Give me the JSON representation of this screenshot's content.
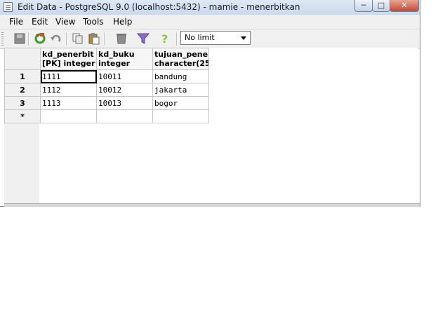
{
  "window": {
    "title": "Edit Data - PostgreSQL 9.0 (localhost:5432) - mamie - menerbitkan",
    "min_glyph": "─",
    "max_glyph": "□",
    "close_glyph": "✕"
  },
  "menu": [
    "File",
    "Edit",
    "View",
    "Tools",
    "Help"
  ],
  "toolbar": {
    "icons": [
      "save-icon",
      "refresh-icon",
      "undo-icon",
      "copy-icon",
      "paste-icon",
      "delete-icon",
      "filter-icon",
      "help-icon"
    ],
    "limit_select": "No limit"
  },
  "grid": {
    "columns": [
      {
        "name": "kd_penerbit",
        "type": "[PK] integer"
      },
      {
        "name": "kd_buku",
        "type": "integer"
      },
      {
        "name": "tujuan_pener",
        "type": "character(25"
      }
    ],
    "rows": [
      {
        "num": "1",
        "cells": [
          "1111",
          "10011",
          "bandung"
        ]
      },
      {
        "num": "2",
        "cells": [
          "1112",
          "10012",
          "jakarta"
        ]
      },
      {
        "num": "3",
        "cells": [
          "1113",
          "10013",
          "bogor"
        ]
      }
    ],
    "new_row_marker": "*"
  },
  "colors": {
    "titlebar": "#c9d8ec",
    "chrome": "#f0f0f0",
    "close_button": "#c24a34",
    "grid_line": "#c6c6c6"
  }
}
